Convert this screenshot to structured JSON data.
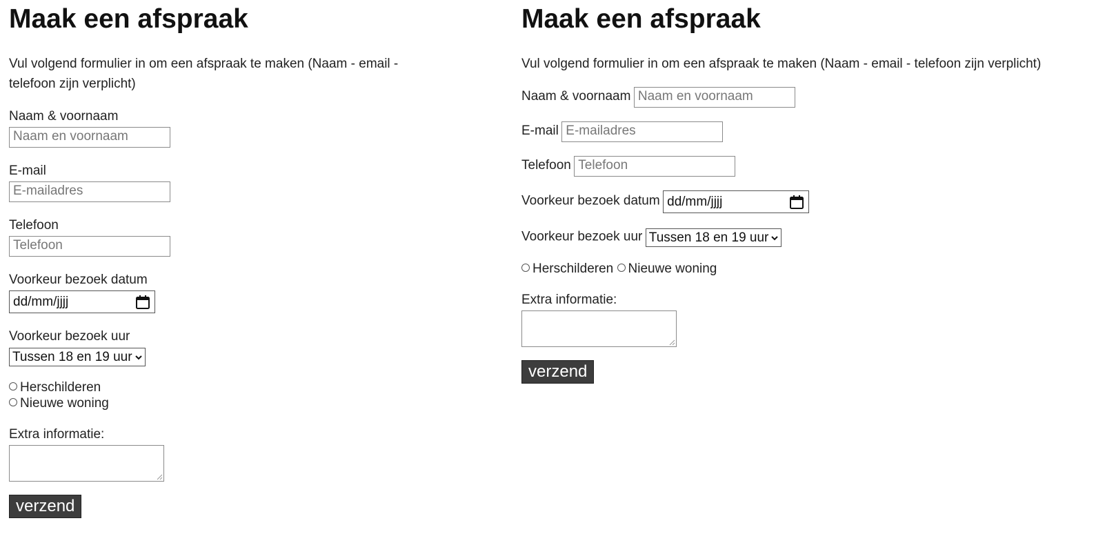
{
  "form": {
    "title": "Maak een afspraak",
    "intro": "Vul volgend formulier in om een afspraak te maken (Naam - email - telefoon zijn verplicht)",
    "name_label": "Naam & voornaam",
    "name_placeholder": "Naam en voornaam",
    "email_label": "E-mail",
    "email_placeholder": "E-mailadres",
    "phone_label": "Telefoon",
    "phone_placeholder": "Telefoon",
    "date_label": "Voorkeur bezoek datum",
    "date_value": "dd/mm/jjjj",
    "time_label": "Voorkeur bezoek uur",
    "time_selected": "Tussen 18 en 19 uur",
    "radio_options": [
      "Herschilderen",
      "Nieuwe woning"
    ],
    "extra_label": "Extra informatie:",
    "extra_value": "",
    "submit_label": "verzend"
  },
  "icons": {
    "date": "calendar-icon",
    "select": "chevron-down-icon",
    "radio": "radio-unchecked-icon",
    "textarea": "resize-grip-icon"
  },
  "colors": {
    "submit_background": "#3d3d3d",
    "submit_text": "#ffffff",
    "text": "#222222",
    "placeholder": "#777777"
  }
}
